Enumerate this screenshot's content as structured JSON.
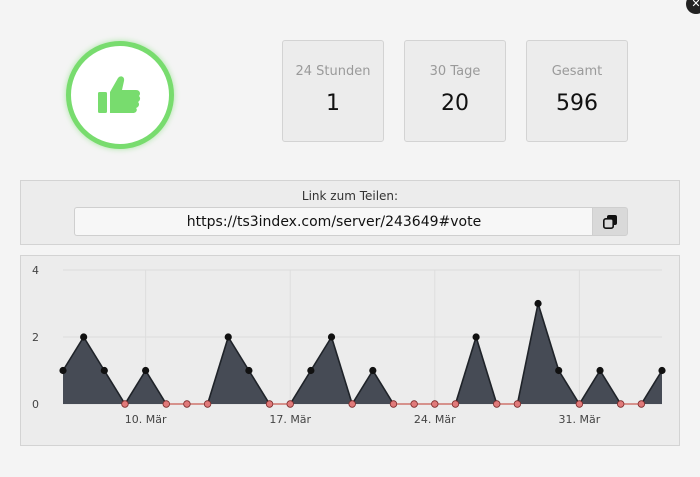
{
  "header": {
    "logo_icon": "thumbs-up-icon",
    "accent_color": "#78dc6e",
    "close_icon": "close-icon"
  },
  "stats": [
    {
      "label": "24 Stunden",
      "value": "1"
    },
    {
      "label": "30 Tage",
      "value": "20"
    },
    {
      "label": "Gesamt",
      "value": "596"
    }
  ],
  "share": {
    "label": "Link zum Teilen:",
    "url": "https://ts3index.com/server/243649#vote",
    "copy_icon": "copy-icon"
  },
  "chart_data": {
    "type": "area",
    "x": [
      "6. Mär",
      "7. Mär",
      "8. Mär",
      "9. Mär",
      "10. Mär",
      "11. Mär",
      "12. Mär",
      "13. Mär",
      "14. Mär",
      "15. Mär",
      "16. Mär",
      "17. Mär",
      "18. Mär",
      "19. Mär",
      "20. Mär",
      "21. Mär",
      "22. Mär",
      "23. Mär",
      "24. Mär",
      "25. Mär",
      "26. Mär",
      "27. Mär",
      "28. Mär",
      "29. Mär",
      "30. Mär",
      "31. Mär",
      "1. Apr",
      "2. Apr",
      "3. Apr",
      "4. Apr"
    ],
    "series": [
      {
        "values": [
          1,
          2,
          1,
          0,
          1,
          0,
          0,
          0,
          2,
          1,
          0,
          0,
          1,
          2,
          0,
          1,
          0,
          0,
          0,
          0,
          2,
          0,
          0,
          3,
          1,
          0,
          1,
          0,
          0,
          1
        ]
      }
    ],
    "x_tick_labels": [
      "10. Mär",
      "17. Mär",
      "24. Mär",
      "31. Mär"
    ],
    "y_ticks": [
      0,
      2,
      4
    ],
    "ylim": [
      0,
      4
    ],
    "grid": true,
    "fill_color": "#464b55",
    "point_color": "#111111",
    "zero_point_color": "#e07a7a",
    "zero_line_color": "#c0392b"
  }
}
